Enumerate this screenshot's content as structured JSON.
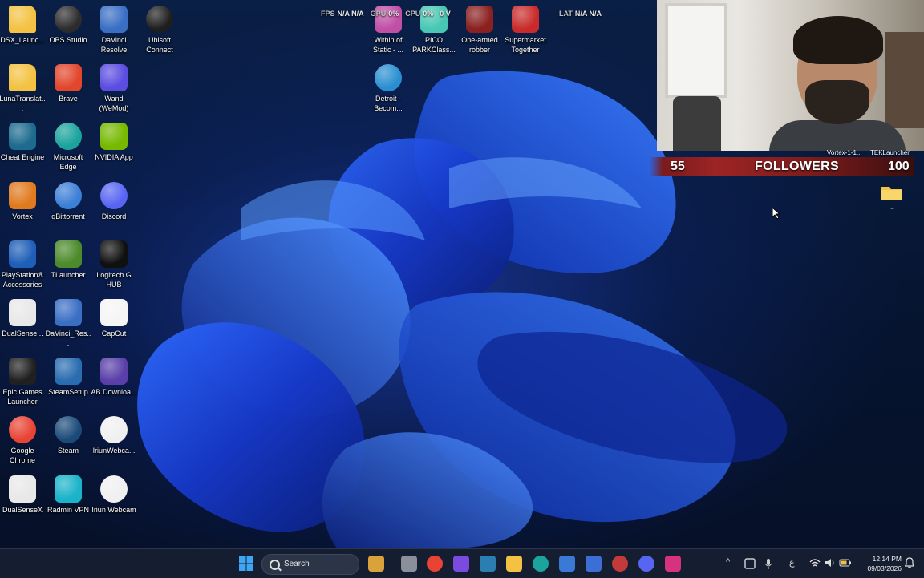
{
  "desktop_icons": [
    {
      "label": "DSX_Launc...",
      "icon": "folder-icon",
      "color": "#f3c242"
    },
    {
      "label": "OBS Studio",
      "icon": "obs-icon",
      "color": "#2c2c2c"
    },
    {
      "label": "DaVinci Resolve",
      "icon": "davinci-icon",
      "color": "#3b6fc4"
    },
    {
      "label": "Ubisoft Connect",
      "icon": "ubisoft-icon",
      "color": "#1e1e1e"
    },
    {
      "label": "LunaTranslat...",
      "icon": "folder-icon",
      "color": "#f3c242"
    },
    {
      "label": "Brave",
      "icon": "brave-icon",
      "color": "#e2462b"
    },
    {
      "label": "Wand (WeMod)",
      "icon": "wand-icon",
      "color": "#5b4de0"
    },
    {
      "label": "Cheat Engine",
      "icon": "cheat-engine-icon",
      "color": "#1d6b8e"
    },
    {
      "label": "Microsoft Edge",
      "icon": "edge-icon",
      "color": "#1ba39c"
    },
    {
      "label": "NVIDIA App",
      "icon": "nvidia-icon",
      "color": "#76b900"
    },
    {
      "label": "Vortex",
      "icon": "vortex-icon",
      "color": "#e07a1f"
    },
    {
      "label": "qBittorrent",
      "icon": "qbittorrent-icon",
      "color": "#3c7fd6"
    },
    {
      "label": "Discord",
      "icon": "discord-icon",
      "color": "#5865f2"
    },
    {
      "label": "PlayStation® Accessories",
      "icon": "playstation-icon",
      "color": "#1f5fb8"
    },
    {
      "label": "TLauncher",
      "icon": "tlauncher-icon",
      "color": "#4c8a2b"
    },
    {
      "label": "Logitech G HUB",
      "icon": "logitech-icon",
      "color": "#101010"
    },
    {
      "label": "DualSense...",
      "icon": "dualsense-icon",
      "color": "#e8e8e8"
    },
    {
      "label": "DaVinci_Res...",
      "icon": "davinci-icon",
      "color": "#3b6fc4"
    },
    {
      "label": "CapCut",
      "icon": "capcut-icon",
      "color": "#f5f5f5"
    },
    {
      "label": "Epic Games Launcher",
      "icon": "epic-games-icon",
      "color": "#202020"
    },
    {
      "label": "SteamSetup",
      "icon": "steam-setup-icon",
      "color": "#2a6cb0"
    },
    {
      "label": "AB Downloa...",
      "icon": "ab-download-icon",
      "color": "#5a3fa8"
    },
    {
      "label": "Google Chrome",
      "icon": "chrome-icon",
      "color": "#e84335"
    },
    {
      "label": "Steam",
      "icon": "steam-icon",
      "color": "#1b4a78"
    },
    {
      "label": "IriunWebca...",
      "icon": "iriun-icon",
      "color": "#f0f0f0"
    },
    {
      "label": "DualSenseX",
      "icon": "dualsense-icon",
      "color": "#e8e8e8"
    },
    {
      "label": "Radmin VPN",
      "icon": "radmin-icon",
      "color": "#1bb3c9"
    },
    {
      "label": "Iriun Webcam",
      "icon": "iriun-icon",
      "color": "#f0f0f0"
    },
    {
      "label": "Within of Static - ...",
      "icon": "game-icon",
      "color": "#c04fa6"
    },
    {
      "label": "PICO PARKClass...",
      "icon": "pico-park-icon",
      "color": "#48c7b4"
    },
    {
      "label": "One-armed robber",
      "icon": "one-armed-robber-icon",
      "color": "#8a2020"
    },
    {
      "label": "Supermarket Together",
      "icon": "supermarket-icon",
      "color": "#c92b2b"
    },
    {
      "label": "Detroit - Becom...",
      "icon": "detroit-icon",
      "color": "#2a8fd0"
    }
  ],
  "overlay": {
    "fps_label": "FPS",
    "fps_value": "N/A N/A",
    "gpu_label": "GPU",
    "gpu_value": "0%",
    "cpu_label": "CPU",
    "cpu_value": "0%",
    "vram_value": "0 V",
    "lat_label": "LAT",
    "lat_value": "N/A N/A"
  },
  "stream": {
    "followers_current": "55",
    "followers_label": "FOLLOWERS",
    "followers_goal": "100",
    "vortex_label": "Vortex-1-1...",
    "tek_label": "TEKLauncher"
  },
  "desktop_folder_label": "...",
  "taskbar": {
    "search_label": "Search",
    "apps": [
      {
        "name": "widgets",
        "color": "#d9a23a"
      },
      {
        "name": "file-manager",
        "color": "#8a8f99"
      },
      {
        "name": "chrome",
        "color": "#e84335"
      },
      {
        "name": "copilot",
        "color": "#7b4be0"
      },
      {
        "name": "cheat-engine",
        "color": "#2a7eb0"
      },
      {
        "name": "file-explorer",
        "color": "#f3c242"
      },
      {
        "name": "edge",
        "color": "#1ba39c"
      },
      {
        "name": "vpn",
        "color": "#3a7ad6"
      },
      {
        "name": "store",
        "color": "#3b6fd6"
      },
      {
        "name": "steam",
        "color": "#c23a3a"
      },
      {
        "name": "discord",
        "color": "#5865f2"
      },
      {
        "name": "instagram",
        "color": "#d6327d"
      }
    ],
    "time": "12:14 PM",
    "date": "09/03/2026",
    "lang": "ع"
  }
}
